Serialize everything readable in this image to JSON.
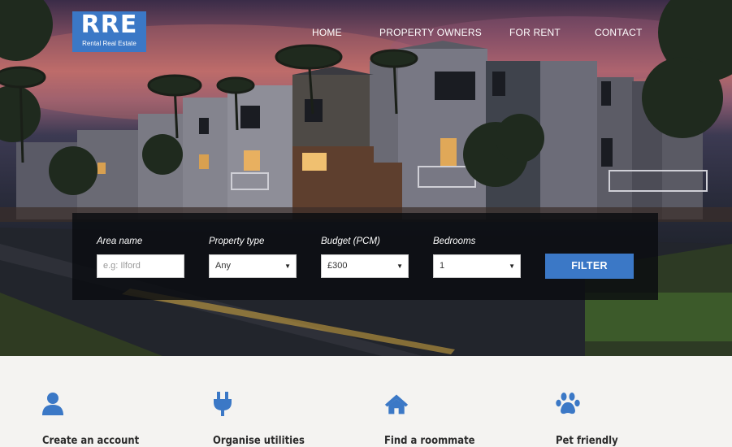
{
  "brand": {
    "logo_text": "RRE",
    "logo_subtitle": "Rental Real Estate",
    "accent": "#3b78c6"
  },
  "nav": {
    "items": [
      {
        "label": "HOME"
      },
      {
        "label": "PROPERTY OWNERS"
      },
      {
        "label": "FOR RENT"
      },
      {
        "label": "CONTACT"
      }
    ]
  },
  "search": {
    "area": {
      "label": "Area name",
      "placeholder": "e.g: Ilford"
    },
    "type": {
      "label": "Property type",
      "value": "Any"
    },
    "budget": {
      "label": "Budget (PCM)",
      "value": "£300"
    },
    "bedrooms": {
      "label": "Bedrooms",
      "value": "1"
    },
    "filter_label": "FILTER"
  },
  "features": [
    {
      "title": "Create an account",
      "icon": "user-icon"
    },
    {
      "title": "Organise utilities",
      "icon": "plug-icon"
    },
    {
      "title": "Find a roommate",
      "icon": "home-icon"
    },
    {
      "title": "Pet friendly",
      "icon": "paw-icon"
    }
  ]
}
